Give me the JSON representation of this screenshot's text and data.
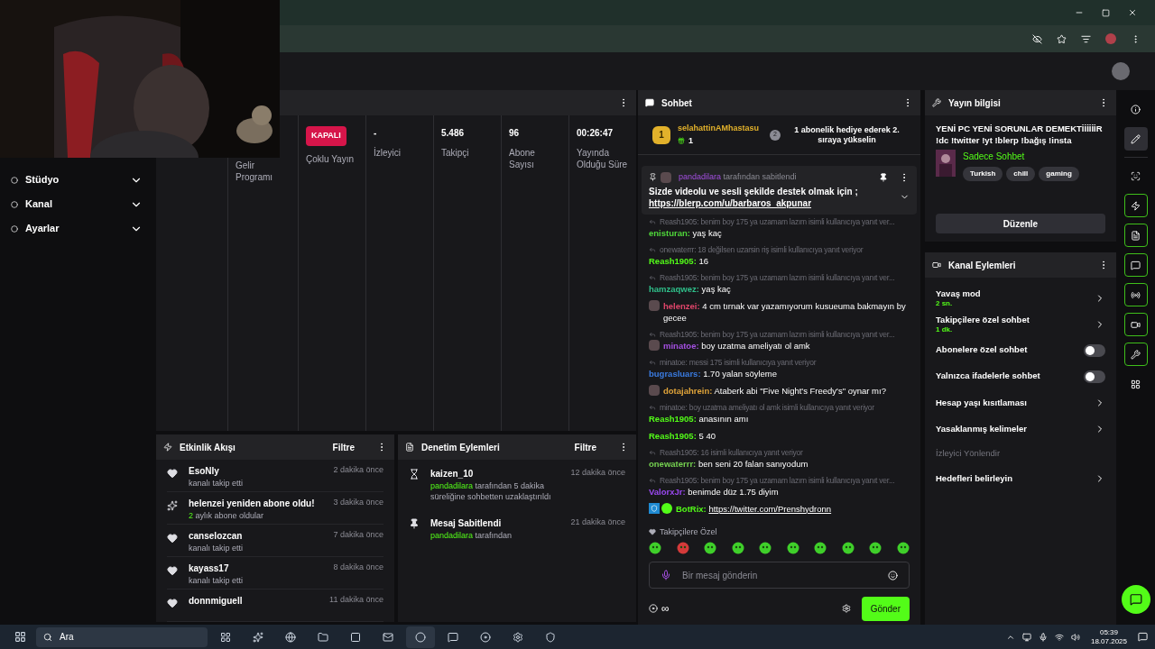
{
  "sidebar": {
    "items": [
      {
        "label": "Stüdyo",
        "expanded": false
      },
      {
        "label": "Kanal",
        "expanded": false
      },
      {
        "label": "Ayarlar",
        "expanded": false
      }
    ]
  },
  "stats": [
    {
      "kind": "badge",
      "value": "KAPALI",
      "label": "Çoklu Yayın"
    },
    {
      "kind": "text",
      "value": "-",
      "label": "İzleyici"
    },
    {
      "kind": "text",
      "value": "5.486",
      "label": "Takipçi"
    },
    {
      "kind": "text",
      "value": "96",
      "label": "Abone Sayısı"
    },
    {
      "kind": "text",
      "value": "00:26:47",
      "label": "Yayında Olduğu Süre"
    }
  ],
  "stats_partial": {
    "label": "Gelir Programı"
  },
  "activity": {
    "title": "Etkinlik Akışı",
    "filter": "Filtre",
    "items": [
      {
        "kind": "follow",
        "name": "EsoNly",
        "detail": "kanalı takip etti",
        "time": "2 dakika önce"
      },
      {
        "kind": "resub",
        "name": "helenzei yeniden abone oldu!",
        "highlight": "2",
        "detail": "aylık abone oldular",
        "time": "3 dakika önce"
      },
      {
        "kind": "follow",
        "name": "canselozcan",
        "detail": "kanalı takip etti",
        "time": "7 dakika önce"
      },
      {
        "kind": "follow",
        "name": "kayass17",
        "detail": "kanalı takip etti",
        "time": "8 dakika önce"
      },
      {
        "kind": "follow",
        "name": "donnmiguell",
        "time": "11 dakika önce"
      }
    ]
  },
  "moderation": {
    "title": "Denetim Eylemleri",
    "filter": "Filtre",
    "items": [
      {
        "kind": "timeout",
        "name": "kaizen_10",
        "by": "pandadilara",
        "detail": "tarafından 5 dakika süreliğine sohbetten uzaklaştırıldı",
        "time": "12 dakika önce"
      },
      {
        "kind": "pin",
        "name": "Mesaj Sabitlendi",
        "by": "pandadilara",
        "detail": "tarafından",
        "time": "21 dakika önce"
      }
    ]
  },
  "chat": {
    "title": "Sohbet",
    "gifter": {
      "rank": "1",
      "name": "selahattinAMhastasu",
      "count": "1",
      "next_rank": "2",
      "prompt": "1 abonelik hediye ederek 2. sıraya yükselin"
    },
    "pinned": {
      "by": "pandadilara",
      "by_suffix": "tarafından sabitlendi",
      "text": "Sizde videolu ve sesli şekilde destek olmak için",
      "after": ";",
      "link": "https://blerp.com/u/barbaros_akpunar"
    },
    "messages": [
      {
        "kind": "plain",
        "reply": "Reash1905: benim boy 175 ya uzamam lazım isimli kullanıcıya yanıt ver...",
        "user": "enisturan:",
        "color": "#4fd63a",
        "text": "yaş kaç"
      },
      {
        "kind": "plain",
        "reply": "onewaterrr: 18 değilsen uzarsin riş isimli kullanıcıya yanıt veriyor",
        "user": "Reash1905:",
        "color": "#53fc18",
        "text": "16"
      },
      {
        "kind": "plain",
        "reply": "Reash1905: benim boy 175 ya uzamam lazım isimli kullanıcıya yanıt ver...",
        "user": "hamzaqwez:",
        "color": "#2fbf8a",
        "text": "yaş kaç"
      },
      {
        "kind": "sub",
        "user": "helenzei:",
        "color": "#e0456a",
        "text": "4 cm tırnak var yazamıyorum kusueuma bakmayın by gecee"
      },
      {
        "kind": "sub",
        "reply": "Reash1905: benim boy 175 ya uzamam lazım isimli kullanıcıya yanıt ver...",
        "user": "minatoe:",
        "color": "#a34fe0",
        "text": "boy uzatma ameliyatı ol amk"
      },
      {
        "kind": "plain",
        "reply": "minatoe: messi 175 isimli kullanıcıya yanıt veriyor",
        "user": "bugrasluars:",
        "color": "#3a7be0",
        "text": "1.70 yalan söyleme"
      },
      {
        "kind": "sub",
        "user": "dotajahrein:",
        "color": "#e0a43a",
        "text": "Ataberk abi \"Five Night's Freedy's\" oynar mı?"
      },
      {
        "kind": "plain",
        "reply": "minatoe: boy uzatma ameliyatı ol amk isimli kullanıcıya yanıt veriyor",
        "user": "Reash1905:",
        "color": "#53fc18",
        "text": "anasının amı"
      },
      {
        "kind": "plain",
        "user": "Reash1905:",
        "color": "#53fc18",
        "text": "5 40"
      },
      {
        "kind": "plain",
        "reply": "Reash1905: 16 isimli kullanıcıya yanıt veriyor",
        "user": "onewaterrr:",
        "color": "#75d050",
        "text": "ben seni 20 falan sanıyodum"
      },
      {
        "kind": "plain",
        "reply": "Reash1905: benim boy 175 ya uzamam lazım isimli kullanıcıya yanıt ver...",
        "user": "ValorxJr:",
        "color": "#9a48f0",
        "text": "benimde düz 1.75 diyim"
      },
      {
        "kind": "bot",
        "user": "BotRix:",
        "color": "#53fc18",
        "link": "https://twitter.com/Prenshydronn"
      }
    ],
    "emote_label": "Takipçilere Özel",
    "placeholder": "Bir mesaj gönderin",
    "points": "∞",
    "send": "Gönder"
  },
  "stream_info": {
    "title": "Yayın bilgisi",
    "stream_title": "YENİ PC YENİ SORUNLAR DEMEKTİİİİİİR !dc !twitter !yt !blerp !bağış !insta",
    "category": "Sadece Sohbet",
    "tags": [
      "Turkish",
      "chill",
      "gaming"
    ],
    "edit": "Düzenle"
  },
  "channel_actions": {
    "title": "Kanal Eylemleri",
    "items": [
      {
        "kind": "link",
        "label": "Yavaş mod",
        "value": "2 sn."
      },
      {
        "kind": "link",
        "label": "Takipçilere özel sohbet",
        "value": "1 dk."
      },
      {
        "kind": "toggle",
        "label": "Abonelere özel sohbet",
        "on": false
      },
      {
        "kind": "toggle",
        "label": "Yalnızca ifadelerle sohbet",
        "on": false
      },
      {
        "kind": "link",
        "label": "Hesap yaşı kısıtlaması"
      },
      {
        "kind": "link",
        "label": "Yasaklanmış kelimeler"
      },
      {
        "kind": "disabled",
        "label": "İzleyici Yönlendir"
      },
      {
        "kind": "link",
        "label": "Hedefleri belirleyin"
      }
    ]
  },
  "rail": [
    {
      "kind": "info",
      "selected": false,
      "on": false
    },
    {
      "kind": "pencil",
      "selected": true,
      "on": false
    },
    {
      "kind": "scan",
      "selected": false,
      "on": false
    },
    {
      "kind": "bolt",
      "selected": false,
      "on": true
    },
    {
      "kind": "doc",
      "selected": false,
      "on": true
    },
    {
      "kind": "chat",
      "selected": false,
      "on": true
    },
    {
      "kind": "broadcast",
      "selected": false,
      "on": true
    },
    {
      "kind": "camera",
      "selected": false,
      "on": true
    },
    {
      "kind": "wrench",
      "selected": false,
      "on": true
    },
    {
      "kind": "dots",
      "selected": false,
      "on": false
    }
  ],
  "taskbar": {
    "search": "Ara",
    "time": "05:39",
    "date": "18.07.2025"
  }
}
